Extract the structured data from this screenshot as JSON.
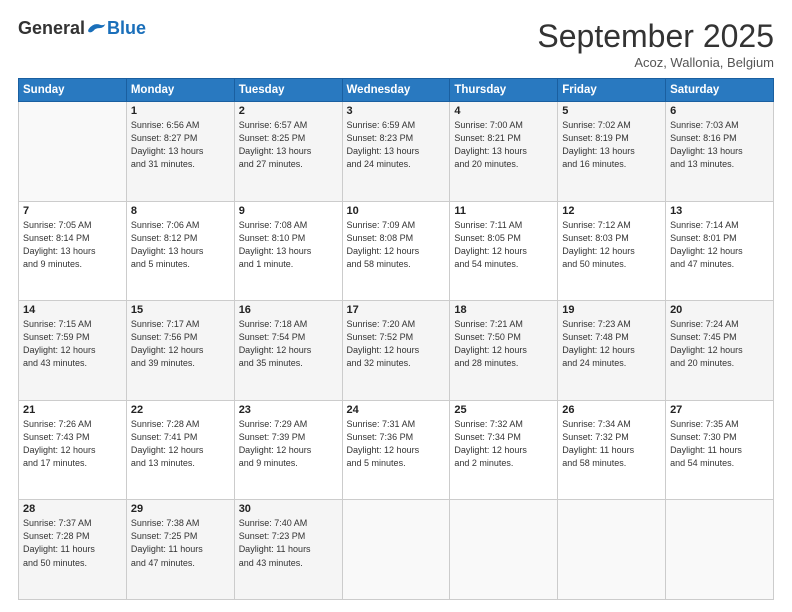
{
  "logo": {
    "general": "General",
    "blue": "Blue"
  },
  "title": "September 2025",
  "subtitle": "Acoz, Wallonia, Belgium",
  "days_of_week": [
    "Sunday",
    "Monday",
    "Tuesday",
    "Wednesday",
    "Thursday",
    "Friday",
    "Saturday"
  ],
  "weeks": [
    [
      {
        "num": "",
        "info": ""
      },
      {
        "num": "1",
        "info": "Sunrise: 6:56 AM\nSunset: 8:27 PM\nDaylight: 13 hours\nand 31 minutes."
      },
      {
        "num": "2",
        "info": "Sunrise: 6:57 AM\nSunset: 8:25 PM\nDaylight: 13 hours\nand 27 minutes."
      },
      {
        "num": "3",
        "info": "Sunrise: 6:59 AM\nSunset: 8:23 PM\nDaylight: 13 hours\nand 24 minutes."
      },
      {
        "num": "4",
        "info": "Sunrise: 7:00 AM\nSunset: 8:21 PM\nDaylight: 13 hours\nand 20 minutes."
      },
      {
        "num": "5",
        "info": "Sunrise: 7:02 AM\nSunset: 8:19 PM\nDaylight: 13 hours\nand 16 minutes."
      },
      {
        "num": "6",
        "info": "Sunrise: 7:03 AM\nSunset: 8:16 PM\nDaylight: 13 hours\nand 13 minutes."
      }
    ],
    [
      {
        "num": "7",
        "info": "Sunrise: 7:05 AM\nSunset: 8:14 PM\nDaylight: 13 hours\nand 9 minutes."
      },
      {
        "num": "8",
        "info": "Sunrise: 7:06 AM\nSunset: 8:12 PM\nDaylight: 13 hours\nand 5 minutes."
      },
      {
        "num": "9",
        "info": "Sunrise: 7:08 AM\nSunset: 8:10 PM\nDaylight: 13 hours\nand 1 minute."
      },
      {
        "num": "10",
        "info": "Sunrise: 7:09 AM\nSunset: 8:08 PM\nDaylight: 12 hours\nand 58 minutes."
      },
      {
        "num": "11",
        "info": "Sunrise: 7:11 AM\nSunset: 8:05 PM\nDaylight: 12 hours\nand 54 minutes."
      },
      {
        "num": "12",
        "info": "Sunrise: 7:12 AM\nSunset: 8:03 PM\nDaylight: 12 hours\nand 50 minutes."
      },
      {
        "num": "13",
        "info": "Sunrise: 7:14 AM\nSunset: 8:01 PM\nDaylight: 12 hours\nand 47 minutes."
      }
    ],
    [
      {
        "num": "14",
        "info": "Sunrise: 7:15 AM\nSunset: 7:59 PM\nDaylight: 12 hours\nand 43 minutes."
      },
      {
        "num": "15",
        "info": "Sunrise: 7:17 AM\nSunset: 7:56 PM\nDaylight: 12 hours\nand 39 minutes."
      },
      {
        "num": "16",
        "info": "Sunrise: 7:18 AM\nSunset: 7:54 PM\nDaylight: 12 hours\nand 35 minutes."
      },
      {
        "num": "17",
        "info": "Sunrise: 7:20 AM\nSunset: 7:52 PM\nDaylight: 12 hours\nand 32 minutes."
      },
      {
        "num": "18",
        "info": "Sunrise: 7:21 AM\nSunset: 7:50 PM\nDaylight: 12 hours\nand 28 minutes."
      },
      {
        "num": "19",
        "info": "Sunrise: 7:23 AM\nSunset: 7:48 PM\nDaylight: 12 hours\nand 24 minutes."
      },
      {
        "num": "20",
        "info": "Sunrise: 7:24 AM\nSunset: 7:45 PM\nDaylight: 12 hours\nand 20 minutes."
      }
    ],
    [
      {
        "num": "21",
        "info": "Sunrise: 7:26 AM\nSunset: 7:43 PM\nDaylight: 12 hours\nand 17 minutes."
      },
      {
        "num": "22",
        "info": "Sunrise: 7:28 AM\nSunset: 7:41 PM\nDaylight: 12 hours\nand 13 minutes."
      },
      {
        "num": "23",
        "info": "Sunrise: 7:29 AM\nSunset: 7:39 PM\nDaylight: 12 hours\nand 9 minutes."
      },
      {
        "num": "24",
        "info": "Sunrise: 7:31 AM\nSunset: 7:36 PM\nDaylight: 12 hours\nand 5 minutes."
      },
      {
        "num": "25",
        "info": "Sunrise: 7:32 AM\nSunset: 7:34 PM\nDaylight: 12 hours\nand 2 minutes."
      },
      {
        "num": "26",
        "info": "Sunrise: 7:34 AM\nSunset: 7:32 PM\nDaylight: 11 hours\nand 58 minutes."
      },
      {
        "num": "27",
        "info": "Sunrise: 7:35 AM\nSunset: 7:30 PM\nDaylight: 11 hours\nand 54 minutes."
      }
    ],
    [
      {
        "num": "28",
        "info": "Sunrise: 7:37 AM\nSunset: 7:28 PM\nDaylight: 11 hours\nand 50 minutes."
      },
      {
        "num": "29",
        "info": "Sunrise: 7:38 AM\nSunset: 7:25 PM\nDaylight: 11 hours\nand 47 minutes."
      },
      {
        "num": "30",
        "info": "Sunrise: 7:40 AM\nSunset: 7:23 PM\nDaylight: 11 hours\nand 43 minutes."
      },
      {
        "num": "",
        "info": ""
      },
      {
        "num": "",
        "info": ""
      },
      {
        "num": "",
        "info": ""
      },
      {
        "num": "",
        "info": ""
      }
    ]
  ]
}
